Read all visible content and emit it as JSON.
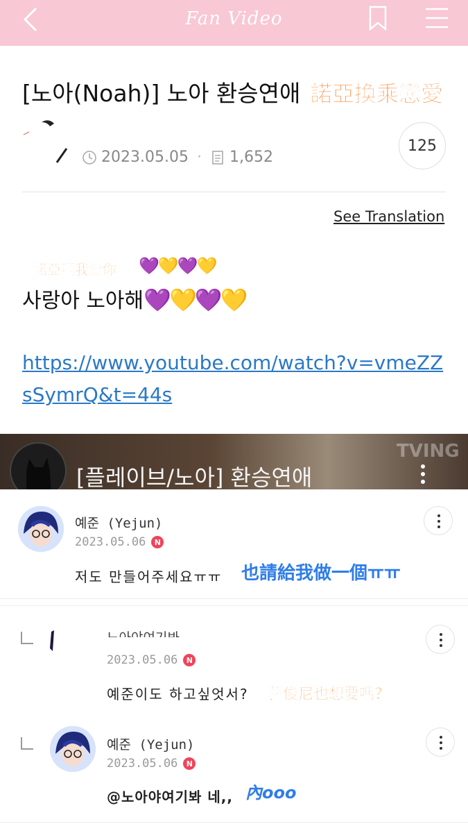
{
  "header": {
    "title": "Fan Video",
    "icons": [
      "back-arrow-icon",
      "bookmark-icon",
      "hamburger-menu-icon"
    ]
  },
  "post": {
    "title": "[노아(Noah)] 노아 환승연애",
    "title_overlay": "諾亞換乘戀愛",
    "date": "2023.05.05",
    "views": "1,652",
    "count": "125",
    "see_translation": "See Translation",
    "love_overlay": "諾亞啊我愛你",
    "body_text": "사랑아 노아해",
    "hearts": "💜💛💜💛",
    "link": "https://www.youtube.com/watch?v=vmeZZsSymrQ&t=44s"
  },
  "video": {
    "title": "[플레이브/노아] 환승연애",
    "watermark": "TVING"
  },
  "comments": [
    {
      "name": "예준 (Yejun)",
      "date": "2023.05.06",
      "badge": "N",
      "text": "저도 만들어주세요ㅠㅠ",
      "overlay": "也請給我做一個ㅠㅠ"
    },
    {
      "name": "노아야여기봐",
      "date": "2023.05.06",
      "badge": "N",
      "text": "예준이도 하고싶엇서?",
      "overlay": "藝俊尼也想要嗎？"
    },
    {
      "name": "예준 (Yejun)",
      "date": "2023.05.06",
      "badge": "N",
      "text": "@노아야여기봐 네,,",
      "overlay": "內ooo"
    }
  ],
  "colors": {
    "header_bg": "#f8c8d4",
    "link": "#2a78c7",
    "overlay_orange": "#ff7a1a",
    "overlay_blue": "#2f7de8",
    "new_badge": "#f0445a"
  }
}
